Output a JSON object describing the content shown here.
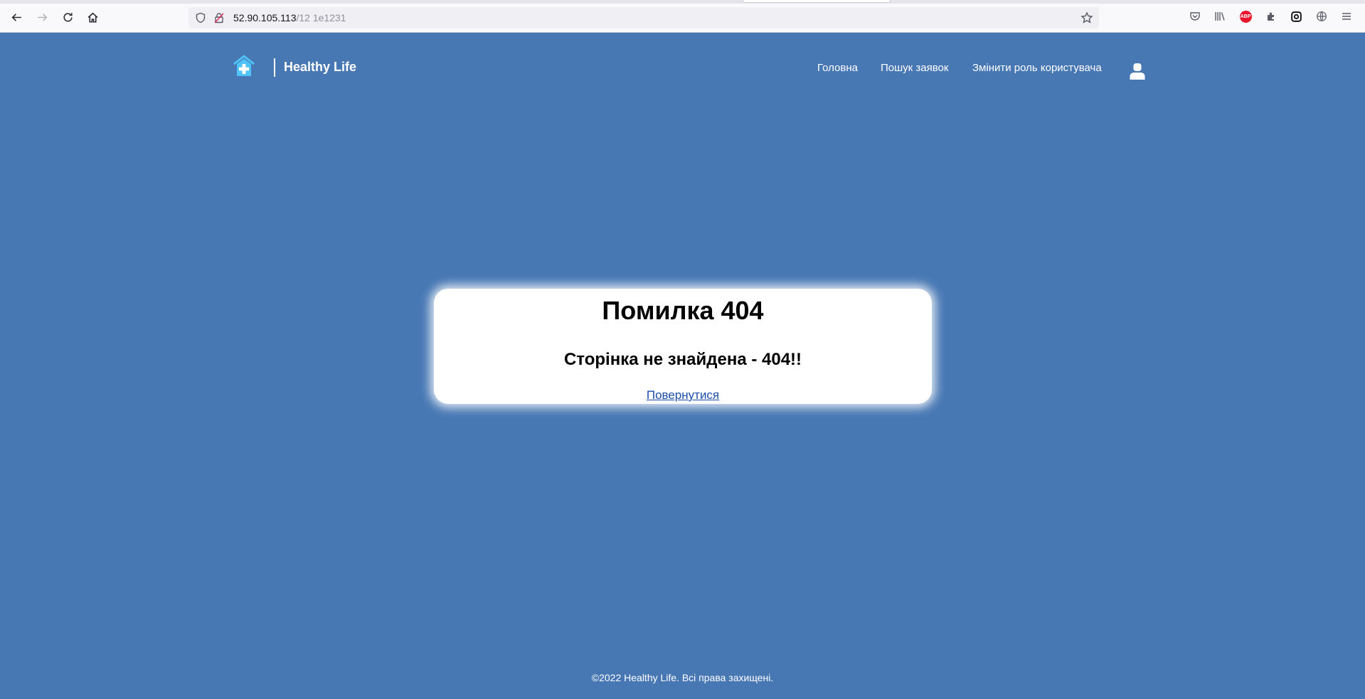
{
  "browser": {
    "url_host": "52.90.105.113",
    "url_path": "/12 1e1231"
  },
  "header": {
    "brand": "Healthy Life",
    "nav": [
      "Головна",
      "Пошук заявок",
      "Змінити роль користувача"
    ]
  },
  "error_card": {
    "title": "Помилка 404",
    "message": "Сторінка не знайдена - 404!!",
    "back_link": "Повернутися"
  },
  "footer": {
    "copyright": "©2022 Healthy Life. Всі права захищені."
  },
  "colors": {
    "page_bg": "#4878b4",
    "logo": "#4fc3f7",
    "link": "#1a4ca8"
  },
  "icons": [
    "back-icon",
    "forward-icon",
    "reload-icon",
    "home-icon",
    "shield-icon",
    "insecure-lock-icon",
    "star-icon",
    "pocket-icon",
    "library-icon",
    "adblock-icon",
    "extension-icon",
    "sync-icon",
    "globe-icon",
    "menu-icon",
    "hospital-logo-icon",
    "user-icon"
  ]
}
